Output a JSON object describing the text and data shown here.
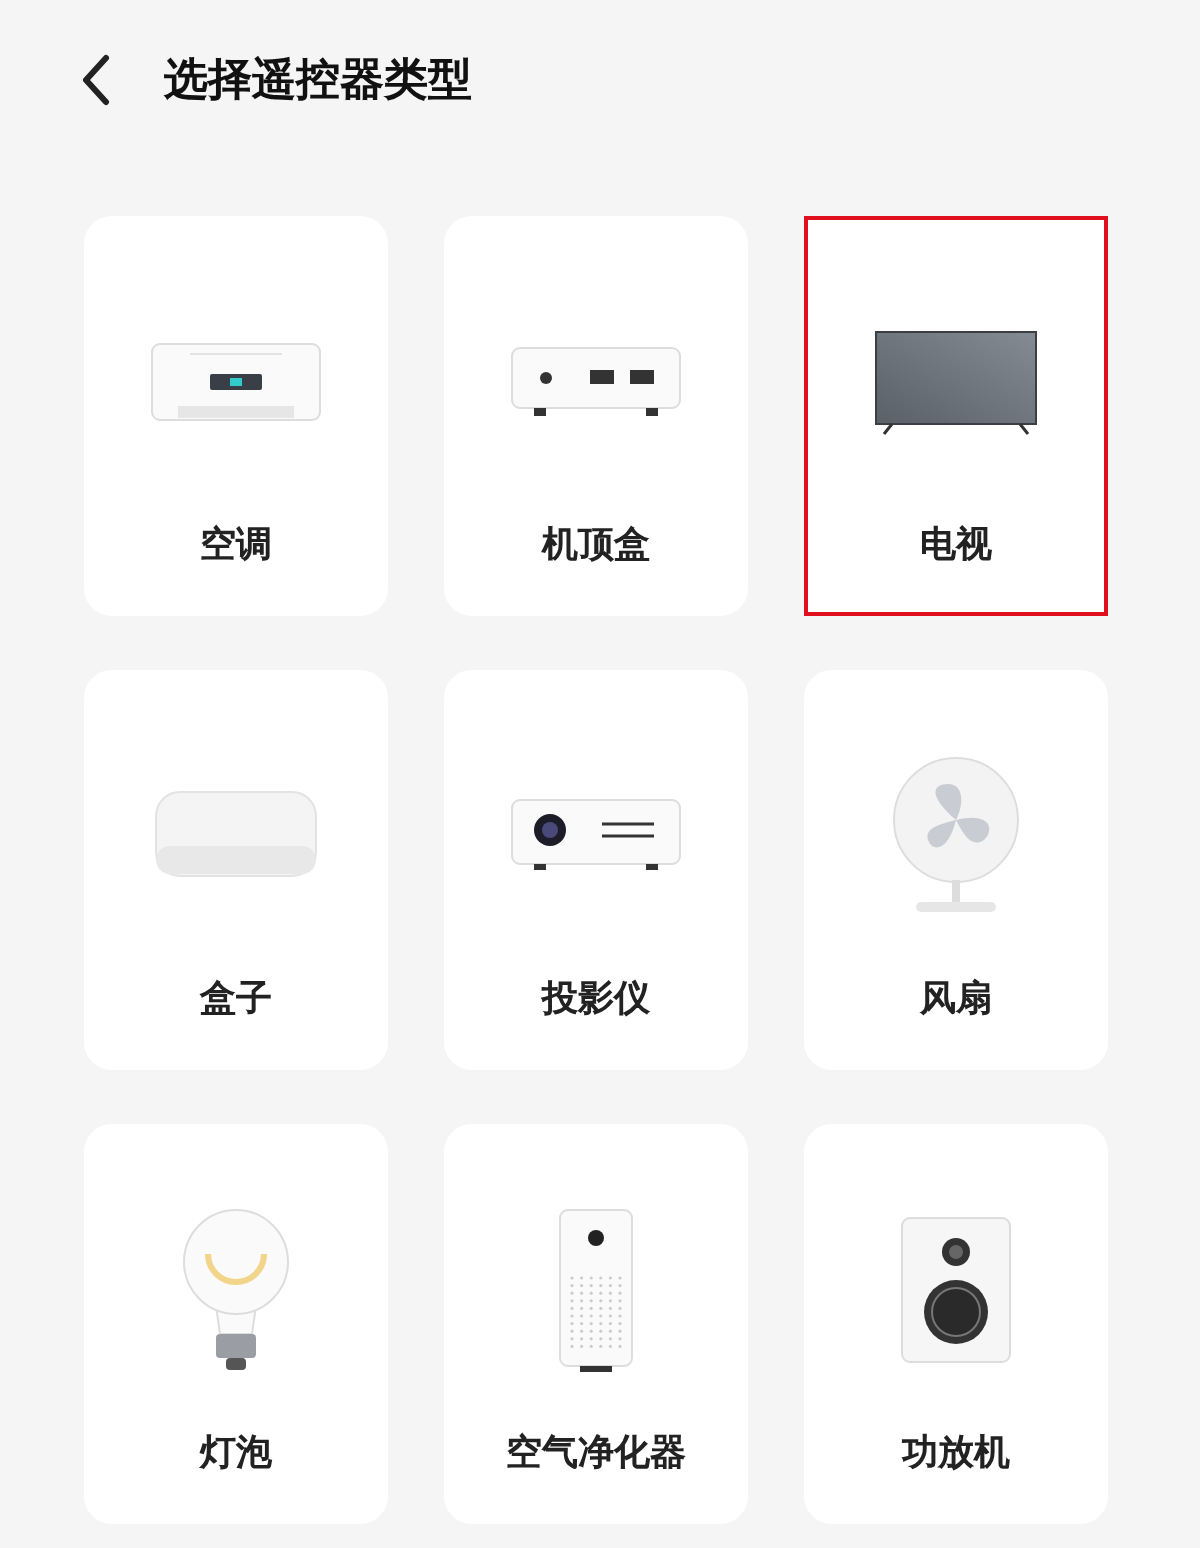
{
  "header": {
    "title": "选择遥控器类型"
  },
  "devices": [
    {
      "kind": "aircon",
      "label": "空调",
      "selected": false
    },
    {
      "kind": "settopbox",
      "label": "机顶盒",
      "selected": false
    },
    {
      "kind": "tv",
      "label": "电视",
      "selected": true
    },
    {
      "kind": "box",
      "label": "盒子",
      "selected": false
    },
    {
      "kind": "projector",
      "label": "投影仪",
      "selected": false
    },
    {
      "kind": "fan",
      "label": "风扇",
      "selected": false
    },
    {
      "kind": "bulb",
      "label": "灯泡",
      "selected": false
    },
    {
      "kind": "purifier",
      "label": "空气净化器",
      "selected": false
    },
    {
      "kind": "speaker",
      "label": "功放机",
      "selected": false
    }
  ]
}
